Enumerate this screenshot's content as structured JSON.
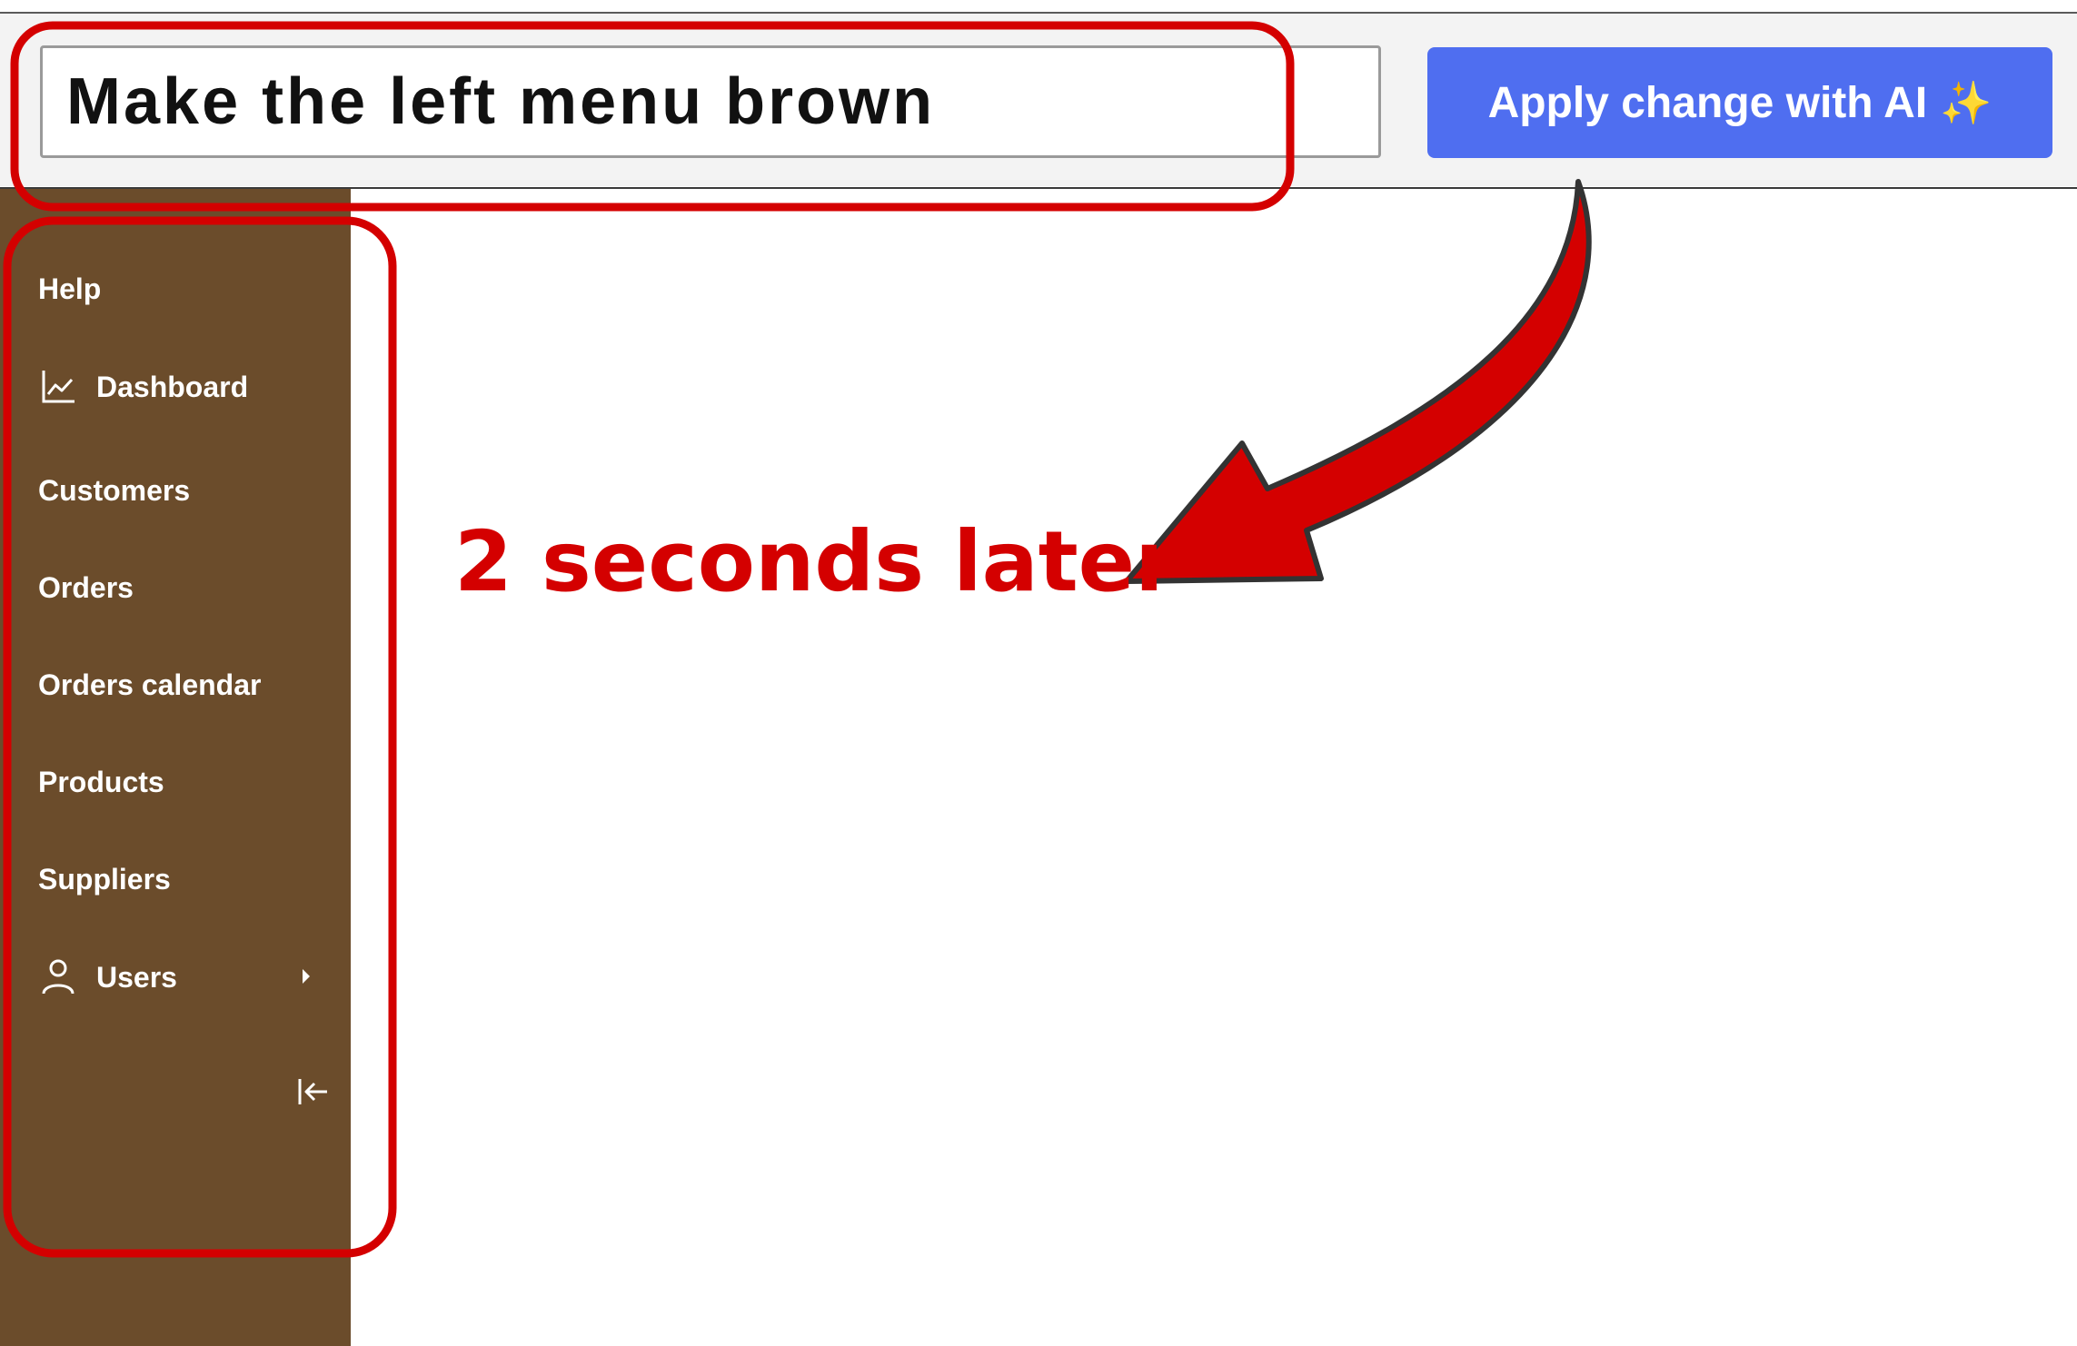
{
  "toolbar": {
    "prompt_value": "Make the left menu brown",
    "apply_label": "Apply change with AI",
    "apply_icon": "sparkles-icon",
    "apply_color": "#4f6ef0"
  },
  "sidebar": {
    "background_color": "#6b4c2b",
    "items": [
      {
        "label": "Help",
        "icon": null
      },
      {
        "label": "Dashboard",
        "icon": "chart-line-icon"
      },
      {
        "label": "Customers",
        "icon": null
      },
      {
        "label": "Orders",
        "icon": null
      },
      {
        "label": "Orders calendar",
        "icon": null
      },
      {
        "label": "Products",
        "icon": null
      },
      {
        "label": "Suppliers",
        "icon": null
      },
      {
        "label": "Users",
        "icon": "user-icon",
        "expandable": true
      }
    ],
    "collapse_icon": "collapse-left-icon"
  },
  "annotation": {
    "caption": "2 seconds later",
    "color": "#d40000"
  }
}
